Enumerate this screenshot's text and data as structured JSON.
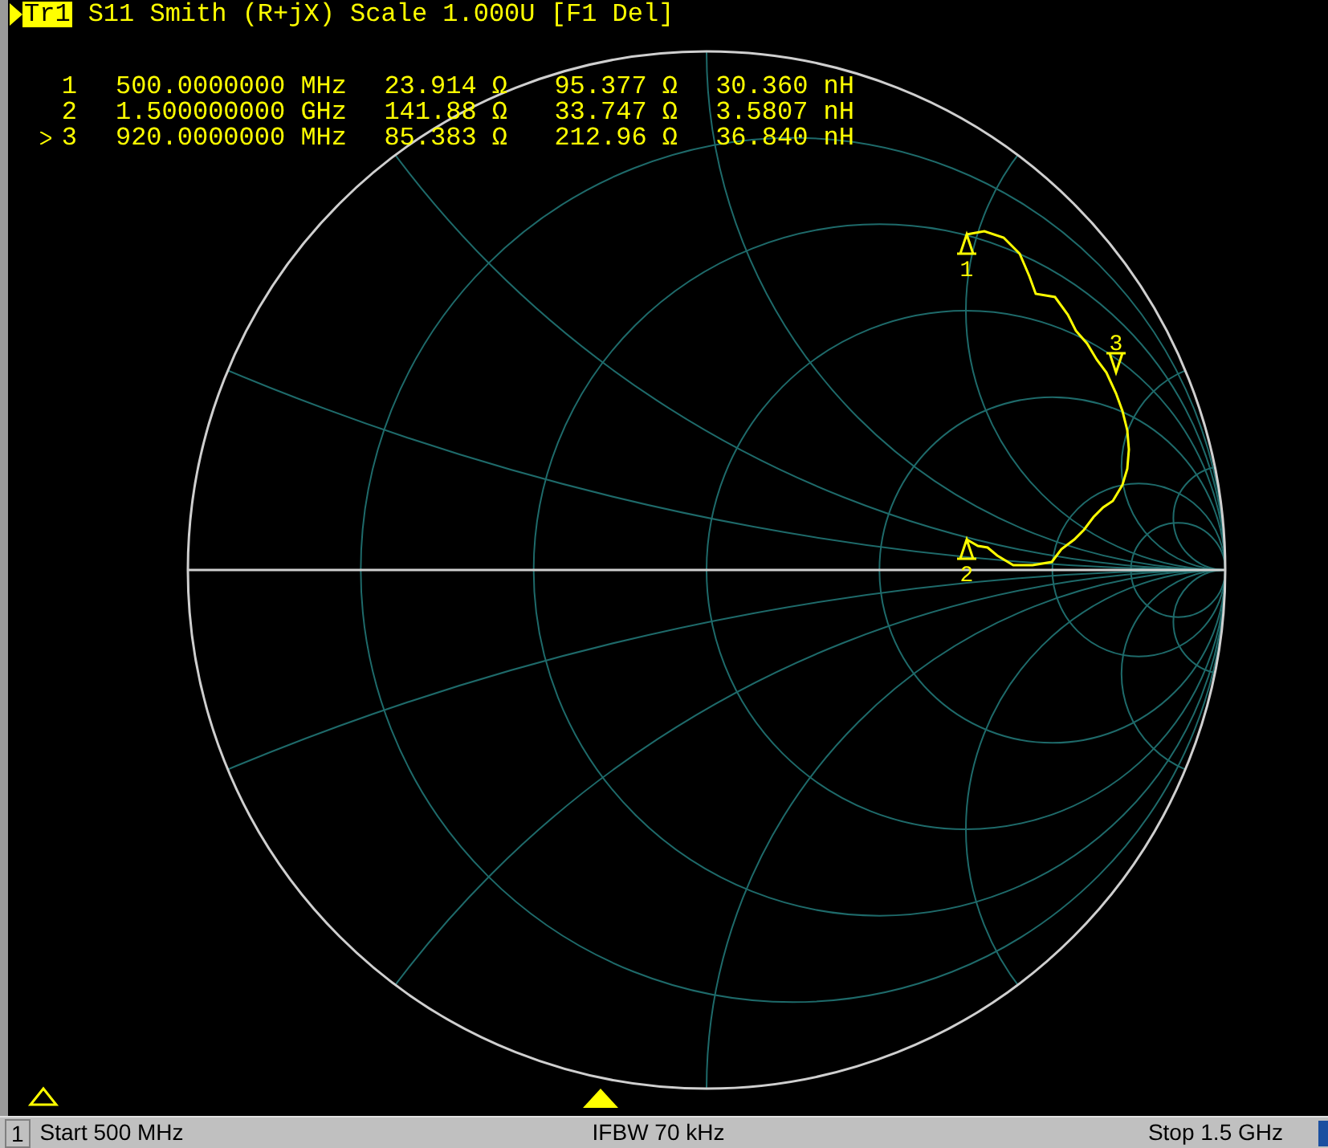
{
  "trace": {
    "label": "Tr1",
    "info": "S11 Smith (R+jX) Scale 1.000U [F1 Del]"
  },
  "markers": [
    {
      "number": "1",
      "frequency": "500.0000000 MHz",
      "resistance": "23.914 Ω",
      "reactance": "95.377 Ω",
      "equivalent": "30.360 nH",
      "selected": false
    },
    {
      "number": "2",
      "frequency": "1.500000000 GHz",
      "resistance": "141.88 Ω",
      "reactance": "33.747 Ω",
      "equivalent": "3.5807 nH",
      "selected": false
    },
    {
      "number": "3",
      "frequency": "920.0000000 MHz",
      "resistance": "85.383 Ω",
      "reactance": "212.96 Ω",
      "equivalent": "36.840 nH",
      "selected": true
    }
  ],
  "chart_marker_labels": [
    "1",
    "2",
    "3"
  ],
  "status_bar": {
    "channel": "1",
    "start": "Start 500 MHz",
    "ifbw": "IFBW 70 kHz",
    "stop": "Stop 1.5 GHz"
  }
}
